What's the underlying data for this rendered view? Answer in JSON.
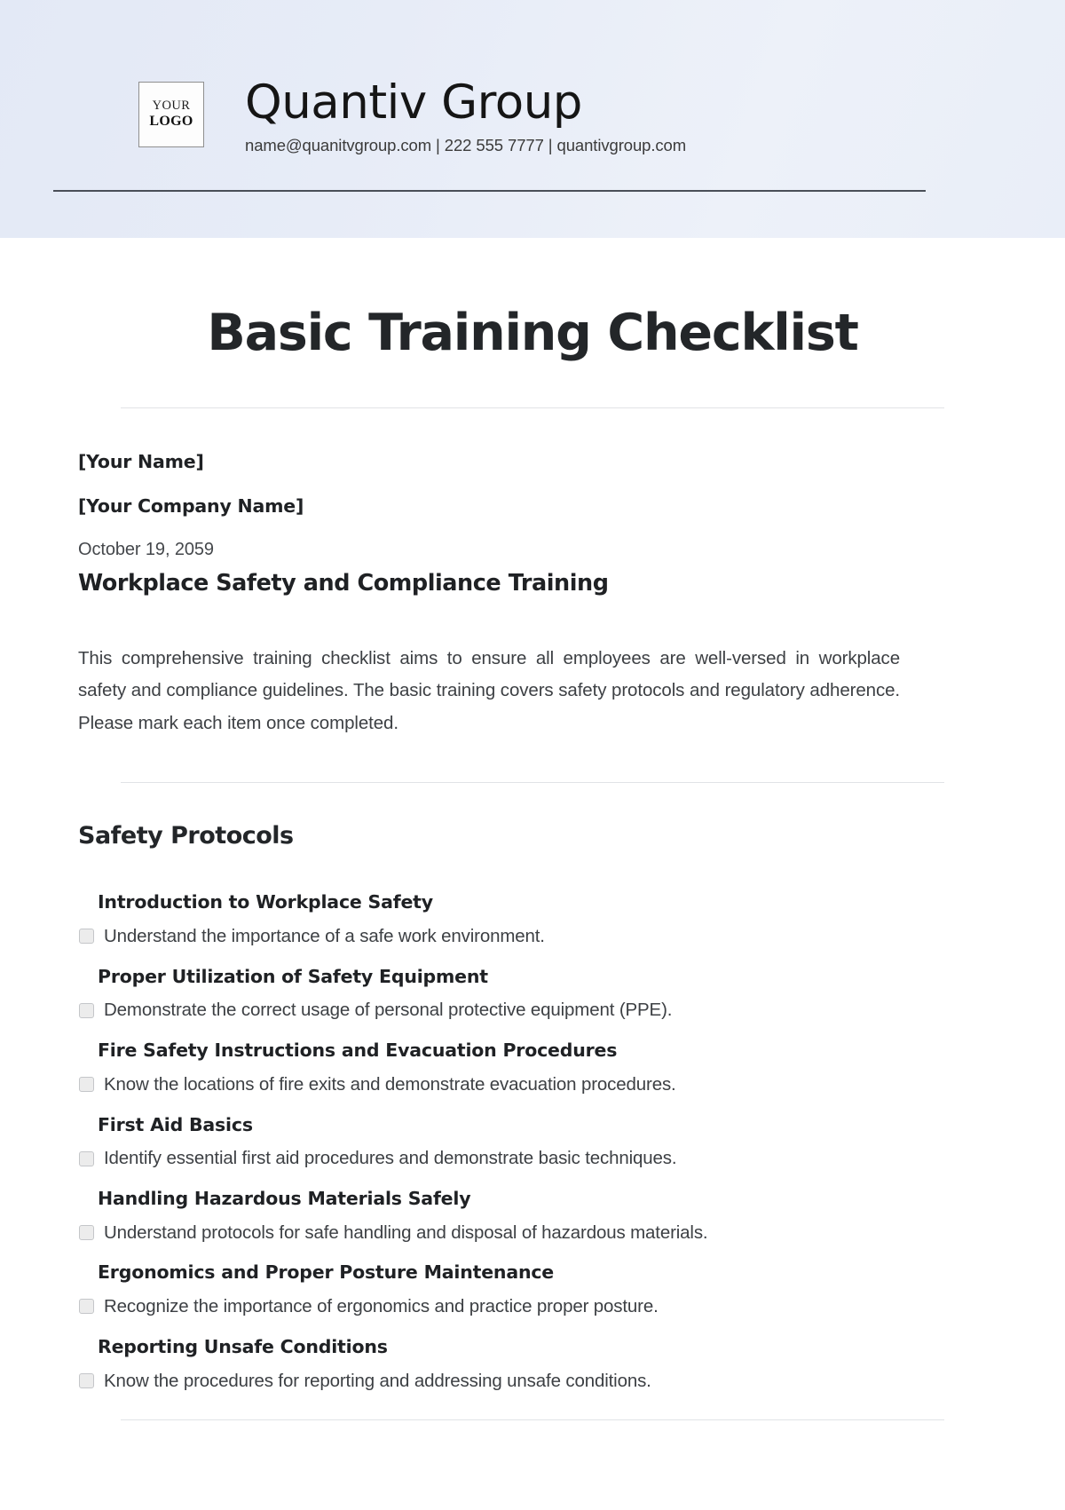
{
  "header": {
    "logo_line1": "YOUR",
    "logo_line2": "LOGO",
    "company_name": "Quantiv Group",
    "contact": "name@quanitvgroup.com | 222 555 7777 | quantivgroup.com"
  },
  "document": {
    "title": "Basic Training Checklist",
    "your_name": "[Your Name]",
    "your_company": "[Your Company Name]",
    "date": "October 19, 2059",
    "topic": "Workplace Safety and Compliance Training",
    "intro": "This comprehensive training checklist aims to ensure all employees are well-versed in workplace safety and compliance guidelines. The basic training covers safety protocols and regulatory adherence. Please mark each item once completed."
  },
  "sections": [
    {
      "title": "Safety Protocols",
      "items": [
        {
          "heading": "Introduction to Workplace Safety",
          "text": "Understand the importance of a safe work environment.",
          "checked": false
        },
        {
          "heading": "Proper Utilization of Safety Equipment",
          "text": "Demonstrate the correct usage of personal protective equipment (PPE).",
          "checked": false
        },
        {
          "heading": "Fire Safety Instructions and Evacuation Procedures",
          "text": "Know the locations of fire exits and demonstrate evacuation procedures.",
          "checked": false
        },
        {
          "heading": "First Aid Basics",
          "text": "Identify essential first aid procedures and demonstrate basic techniques.",
          "checked": false
        },
        {
          "heading": "Handling Hazardous Materials Safely",
          "text": "Understand protocols for safe handling and disposal of hazardous materials.",
          "checked": false
        },
        {
          "heading": "Ergonomics and Proper Posture Maintenance",
          "text": "Recognize the importance of ergonomics and practice proper posture.",
          "checked": false
        },
        {
          "heading": "Reporting Unsafe Conditions",
          "text": "Know the procedures for reporting and addressing unsafe conditions.",
          "checked": false
        }
      ]
    }
  ],
  "colors": {
    "header_band": "#e7ecf7",
    "rule_dark": "#4a4f58",
    "rule_light": "#e1e3e6",
    "text_primary": "#232629",
    "text_body": "#3d4044",
    "checkbox_fill": "#ececec"
  }
}
